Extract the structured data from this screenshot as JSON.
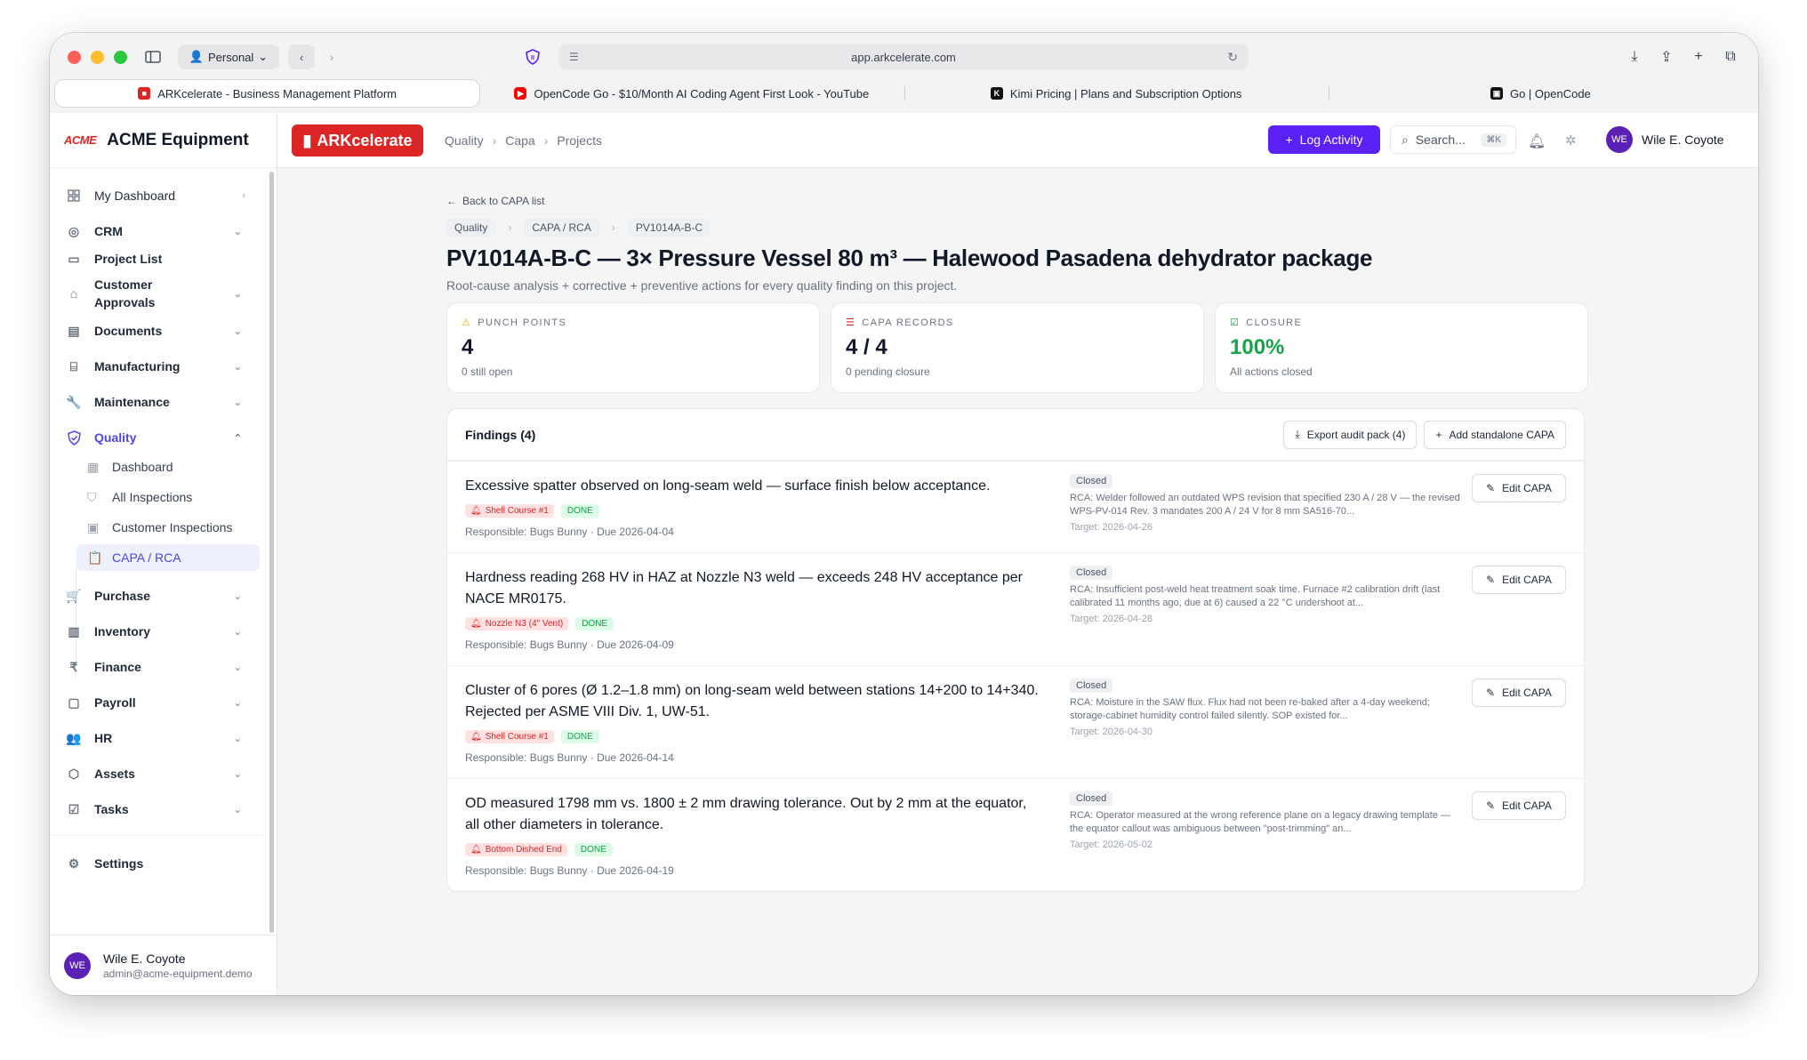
{
  "browser": {
    "profile": "Personal",
    "url": "app.arkcelerate.com",
    "tabs": [
      {
        "title": "ARKcelerate - Business Management Platform",
        "active": true,
        "favicon_color": "#dc2626"
      },
      {
        "title": "OpenCode Go - $10/Month AI Coding Agent First Look - YouTube",
        "active": false,
        "favicon_color": "#ff0000"
      },
      {
        "title": "Kimi Pricing | Plans and Subscription Options",
        "active": false,
        "favicon_color": "#111111"
      },
      {
        "title": "Go | OpenCode",
        "active": false,
        "favicon_color": "#111111"
      }
    ]
  },
  "sidebar": {
    "logo": "ACME",
    "company": "ACME Equipment",
    "items": [
      {
        "label": "My Dashboard",
        "icon": "dashboard-icon"
      },
      {
        "label": "CRM",
        "icon": "target-icon"
      },
      {
        "label": "Project List",
        "icon": "folder-icon"
      },
      {
        "label": "Customer Approvals",
        "icon": "tag-icon"
      },
      {
        "label": "Documents",
        "icon": "document-icon"
      },
      {
        "label": "Manufacturing",
        "icon": "factory-icon"
      },
      {
        "label": "Maintenance",
        "icon": "wrench-icon"
      },
      {
        "label": "Quality",
        "icon": "shield-check-icon"
      },
      {
        "label": "Purchase",
        "icon": "cart-icon"
      },
      {
        "label": "Inventory",
        "icon": "warehouse-icon"
      },
      {
        "label": "Finance",
        "icon": "rupee-icon"
      },
      {
        "label": "Payroll",
        "icon": "wallet-icon"
      },
      {
        "label": "HR",
        "icon": "users-icon"
      },
      {
        "label": "Assets",
        "icon": "box-icon"
      },
      {
        "label": "Tasks",
        "icon": "checkbox-icon"
      },
      {
        "label": "Settings",
        "icon": "gear-icon"
      }
    ],
    "quality_sub": [
      "Dashboard",
      "All Inspections",
      "Customer Inspections",
      "CAPA / RCA"
    ],
    "user": {
      "initials": "WE",
      "name": "Wile E. Coyote",
      "email": "admin@acme-equipment.demo"
    }
  },
  "topbar": {
    "app_logo": "ARKcelerate",
    "breadcrumb": [
      "Quality",
      "Capa",
      "Projects"
    ],
    "log_activity": "Log Activity",
    "search": "Search...",
    "search_kbd": "⌘K",
    "user_initials": "WE",
    "user_name": "Wile E. Coyote"
  },
  "page": {
    "back_link": "Back to CAPA list",
    "chips": [
      "Quality",
      "CAPA / RCA",
      "PV1014A-B-C"
    ],
    "title": "PV1014A-B-C — 3× Pressure Vessel 80 m³ — Halewood Pasadena dehydrator package",
    "subtitle": "Root-cause analysis + corrective + preventive actions for every quality finding on this project.",
    "kpis": [
      {
        "label": "PUNCH POINTS",
        "value": "4",
        "note": "0 still open",
        "icon": "warning-icon",
        "color": "#f59e0b"
      },
      {
        "label": "CAPA RECORDS",
        "value": "4 / 4",
        "note": "0 pending closure",
        "icon": "list-check-icon",
        "color": "#dc2626"
      },
      {
        "label": "CLOSURE",
        "value": "100%",
        "note": "All actions closed",
        "icon": "clipboard-check-icon",
        "color": "#16a34a"
      }
    ],
    "findings_title": "Findings (4)",
    "export_btn": "Export audit pack (4)",
    "add_btn": "Add standalone CAPA",
    "findings": [
      {
        "title": "Excessive spatter observed on long-seam weld — surface finish below acceptance.",
        "location": "Shell Course #1",
        "state": "DONE",
        "meta": "Responsible: Bugs Bunny · Due 2026-04-04",
        "status": "Closed",
        "rca": "RCA: Welder followed an outdated WPS revision that specified 230 A / 28 V — the revised WPS-PV-014 Rev. 3 mandates 200 A / 24 V for 8 mm SA516-70...",
        "target": "Target: 2026-04-26",
        "edit": "Edit CAPA"
      },
      {
        "title": "Hardness reading 268 HV in HAZ at Nozzle N3 weld — exceeds 248 HV acceptance per NACE MR0175.",
        "location": "Nozzle N3 (4\" Vent)",
        "state": "DONE",
        "meta": "Responsible: Bugs Bunny · Due 2026-04-09",
        "status": "Closed",
        "rca": "RCA: Insufficient post-weld heat treatment soak time. Furnace #2 calibration drift (last calibrated 11 months ago, due at 6) caused a 22 °C undershoot at...",
        "target": "Target: 2026-04-28",
        "edit": "Edit CAPA"
      },
      {
        "title": "Cluster of 6 pores (Ø 1.2–1.8 mm) on long-seam weld between stations 14+200 to 14+340. Rejected per ASME VIII Div. 1, UW-51.",
        "location": "Shell Course #1",
        "state": "DONE",
        "meta": "Responsible: Bugs Bunny · Due 2026-04-14",
        "status": "Closed",
        "rca": "RCA: Moisture in the SAW flux. Flux had not been re-baked after a 4-day weekend; storage-cabinet humidity control failed silently. SOP existed for...",
        "target": "Target: 2026-04-30",
        "edit": "Edit CAPA"
      },
      {
        "title": "OD measured 1798 mm vs. 1800 ± 2 mm drawing tolerance. Out by 2 mm at the equator, all other diameters in tolerance.",
        "location": "Bottom Dished End",
        "state": "DONE",
        "meta": "Responsible: Bugs Bunny · Due 2026-04-19",
        "status": "Closed",
        "rca": "RCA: Operator measured at the wrong reference plane on a legacy drawing template — the equator callout was ambiguous between \"post-trimming\" an...",
        "target": "Target: 2026-05-02",
        "edit": "Edit CAPA"
      }
    ]
  }
}
